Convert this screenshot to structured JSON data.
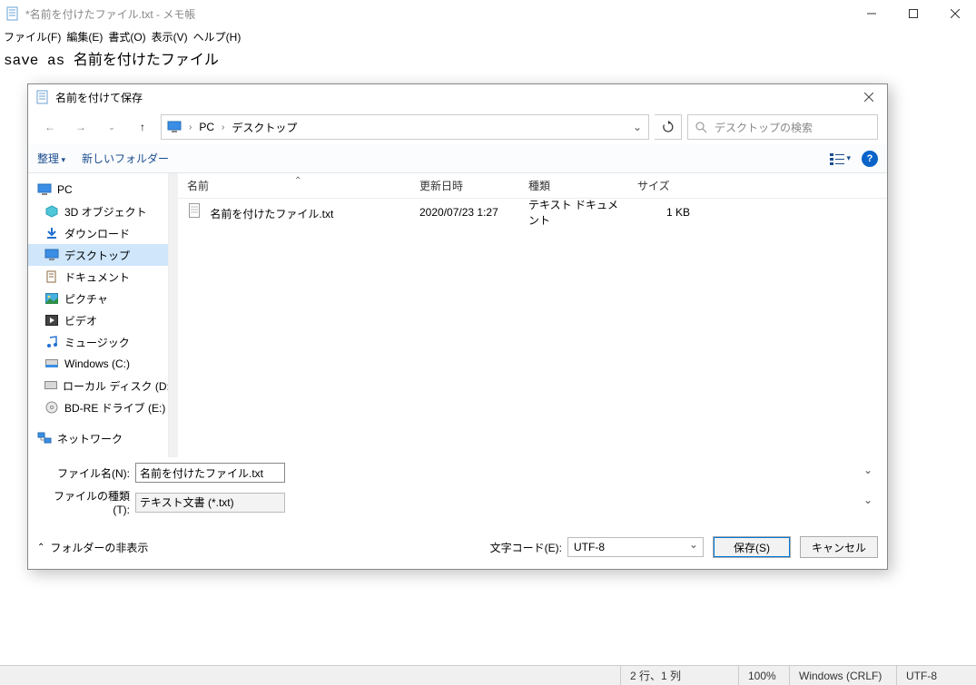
{
  "notepad": {
    "window_title": "*名前を付けたファイル.txt - メモ帳",
    "menus": {
      "file": "ファイル(F)",
      "edit": "編集(E)",
      "format": "書式(O)",
      "view": "表示(V)",
      "help": "ヘルプ(H)"
    },
    "body_text": "save as 名前を付けたファイル",
    "status": {
      "cursor": "2 行、1 列",
      "zoom": "100%",
      "line_ending": "Windows (CRLF)",
      "encoding": "UTF-8"
    }
  },
  "dialog": {
    "title": "名前を付けて保存",
    "breadcrumb": {
      "root": "PC",
      "leaf": "デスクトップ"
    },
    "search_placeholder": "デスクトップの検索",
    "toolbar": {
      "organize": "整理",
      "new_folder": "新しいフォルダー"
    },
    "tree": {
      "root": "PC",
      "items": [
        "3D オブジェクト",
        "ダウンロード",
        "デスクトップ",
        "ドキュメント",
        "ピクチャ",
        "ビデオ",
        "ミュージック",
        "Windows (C:)",
        "ローカル ディスク (D:)",
        "BD-RE ドライブ (E:)"
      ],
      "network": "ネットワーク"
    },
    "columns": {
      "name": "名前",
      "date": "更新日時",
      "type": "種類",
      "size": "サイズ"
    },
    "files": [
      {
        "name": "名前を付けたファイル.txt",
        "date": "2020/07/23 1:27",
        "type": "テキスト ドキュメント",
        "size": "1 KB"
      }
    ],
    "filename_label": "ファイル名(N):",
    "filename_value": "名前を付けたファイル.txt",
    "filetype_label": "ファイルの種類(T):",
    "filetype_value": "テキスト文書 (*.txt)",
    "hide_folders": "フォルダーの非表示",
    "encoding_label": "文字コード(E):",
    "encoding_value": "UTF-8",
    "save_label": "保存(S)",
    "cancel_label": "キャンセル"
  }
}
